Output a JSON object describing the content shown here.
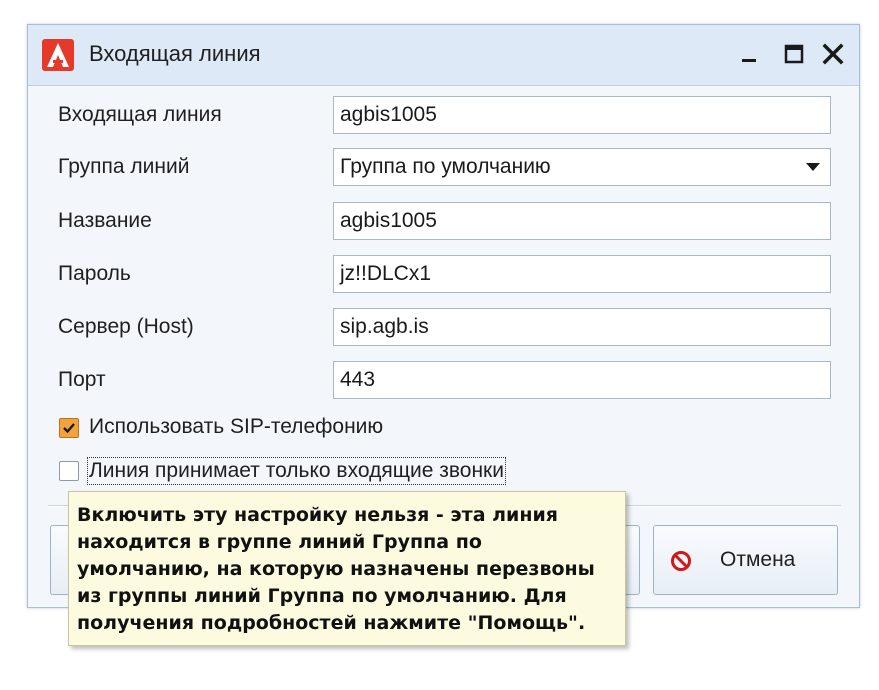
{
  "window": {
    "title": "Входящая линия",
    "controls": {
      "minimize": "minimize",
      "maximize": "maximize",
      "close": "close"
    }
  },
  "form": {
    "incoming_line": {
      "label": "Входящая линия",
      "value": "agbis1005"
    },
    "line_group": {
      "label": "Группа линий",
      "value": "Группа по умолчанию"
    },
    "name": {
      "label": "Название",
      "value": "agbis1005"
    },
    "password": {
      "label": "Пароль",
      "value": "jz!!DLCx1"
    },
    "server": {
      "label": "Сервер (Host)",
      "value": "sip.agb.is"
    },
    "port": {
      "label": "Порт",
      "value": "443"
    },
    "use_sip": {
      "label": "Использовать SIP-телефонию",
      "checked": true
    },
    "incoming_only": {
      "label": "Линия принимает только входящие звонки",
      "checked": false
    }
  },
  "buttons": {
    "cancel_label": "Отмена"
  },
  "tooltip": {
    "text": "Включить эту настройку нельзя - эта линия находится в группе линий Группа по умолчанию, на которую назначены перезвоны из группы линий Группа по умолчанию. Для получения подробностей нажмите \"Помощь\"."
  },
  "colors": {
    "accent_checkbox": "#f3a33a",
    "titlebar": "#dde9f6",
    "tooltip_bg": "#fcfbe0",
    "cancel_icon": "#d01818"
  }
}
